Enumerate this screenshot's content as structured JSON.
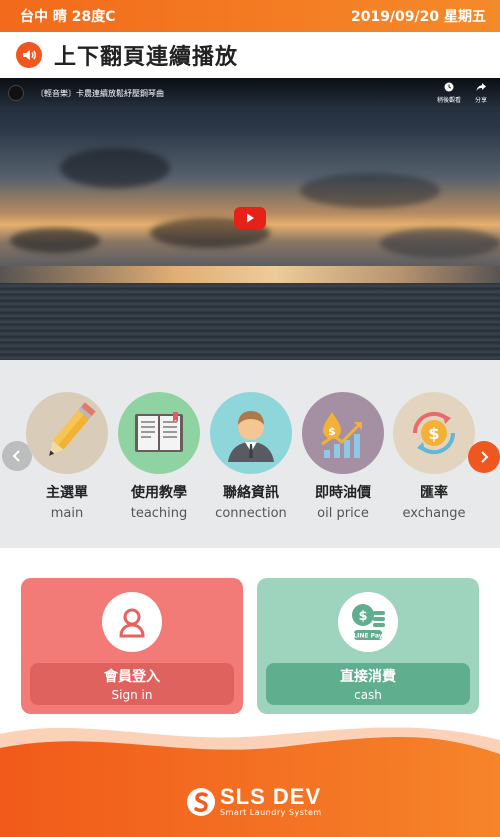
{
  "status": {
    "location_weather": "台中 晴 28度C",
    "datetime": "2019/09/20 星期五"
  },
  "header": {
    "title": "上下翻頁連續播放"
  },
  "video": {
    "title": "〔輕音樂〕卡農連續放鬆紓壓鋼琴曲",
    "watch_later": "稍後觀看",
    "share": "分享"
  },
  "menu": {
    "items": [
      {
        "zh": "主選單",
        "en": "main",
        "icon": "pencil-icon",
        "color": "#d9cdb9"
      },
      {
        "zh": "使用教學",
        "en": "teaching",
        "icon": "book-icon",
        "color": "#8fd3a3"
      },
      {
        "zh": "聯絡資訊",
        "en": "connection",
        "icon": "person-icon",
        "color": "#8fd6db"
      },
      {
        "zh": "即時油價",
        "en": "oil price",
        "icon": "oil-chart-icon",
        "color": "#a58fa3"
      },
      {
        "zh": "匯率",
        "en": "exchange",
        "icon": "currency-exchange-icon",
        "color": "#e3d4bf"
      }
    ]
  },
  "actions": {
    "signin": {
      "zh": "會員登入",
      "en": "Sign in",
      "card_color": "#f27b78",
      "button_color": "#e0625f"
    },
    "cash": {
      "zh": "直接消費",
      "en": "cash",
      "card_color": "#9ed4be",
      "button_color": "#5fae8d",
      "badge": "LINE Pay"
    }
  },
  "footer": {
    "brand": "SLS DEV",
    "tagline": "Smart Laundry System"
  }
}
